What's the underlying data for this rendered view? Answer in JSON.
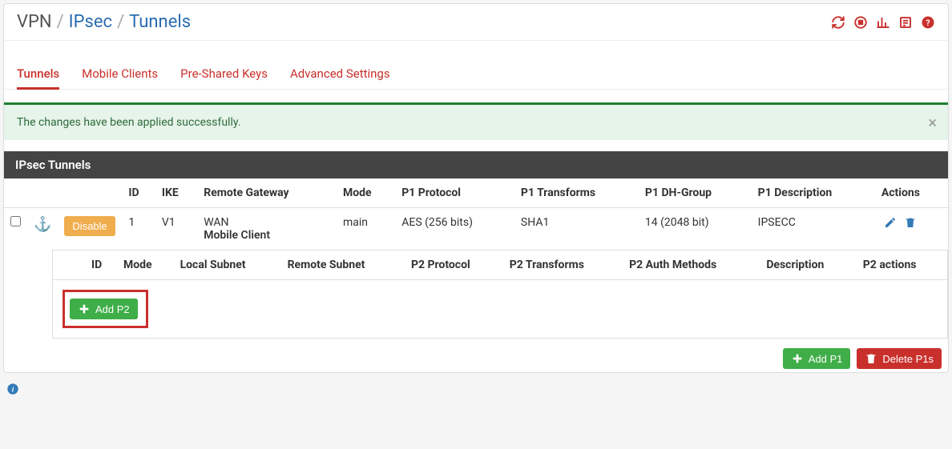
{
  "breadcrumb": {
    "part1": "VPN",
    "part2": "IPsec",
    "part3": "Tunnels"
  },
  "tabs": {
    "tunnels": "Tunnels",
    "mobile": "Mobile Clients",
    "psk": "Pre-Shared Keys",
    "advanced": "Advanced Settings"
  },
  "alert": {
    "message": "The changes have been applied successfully."
  },
  "section_title": "IPsec Tunnels",
  "p1_headers": {
    "id": "ID",
    "ike": "IKE",
    "gateway": "Remote Gateway",
    "mode": "Mode",
    "proto": "P1 Protocol",
    "transforms": "P1 Transforms",
    "dh": "P1 DH-Group",
    "desc": "P1 Description",
    "actions": "Actions"
  },
  "p1_row": {
    "disable_label": "Disable",
    "id": "1",
    "ike": "V1",
    "gateway_line1": "WAN",
    "gateway_line2": "Mobile Client",
    "mode": "main",
    "proto": "AES (256 bits)",
    "transforms": "SHA1",
    "dh": "14 (2048 bit)",
    "desc": "IPSECC"
  },
  "p2_headers": {
    "id": "ID",
    "mode": "Mode",
    "local": "Local Subnet",
    "remote": "Remote Subnet",
    "proto": "P2 Protocol",
    "transforms": "P2 Transforms",
    "auth": "P2 Auth Methods",
    "desc": "Description",
    "actions": "P2 actions"
  },
  "buttons": {
    "add_p2": "Add P2",
    "add_p1": "Add P1",
    "delete_p1s": "Delete P1s"
  }
}
